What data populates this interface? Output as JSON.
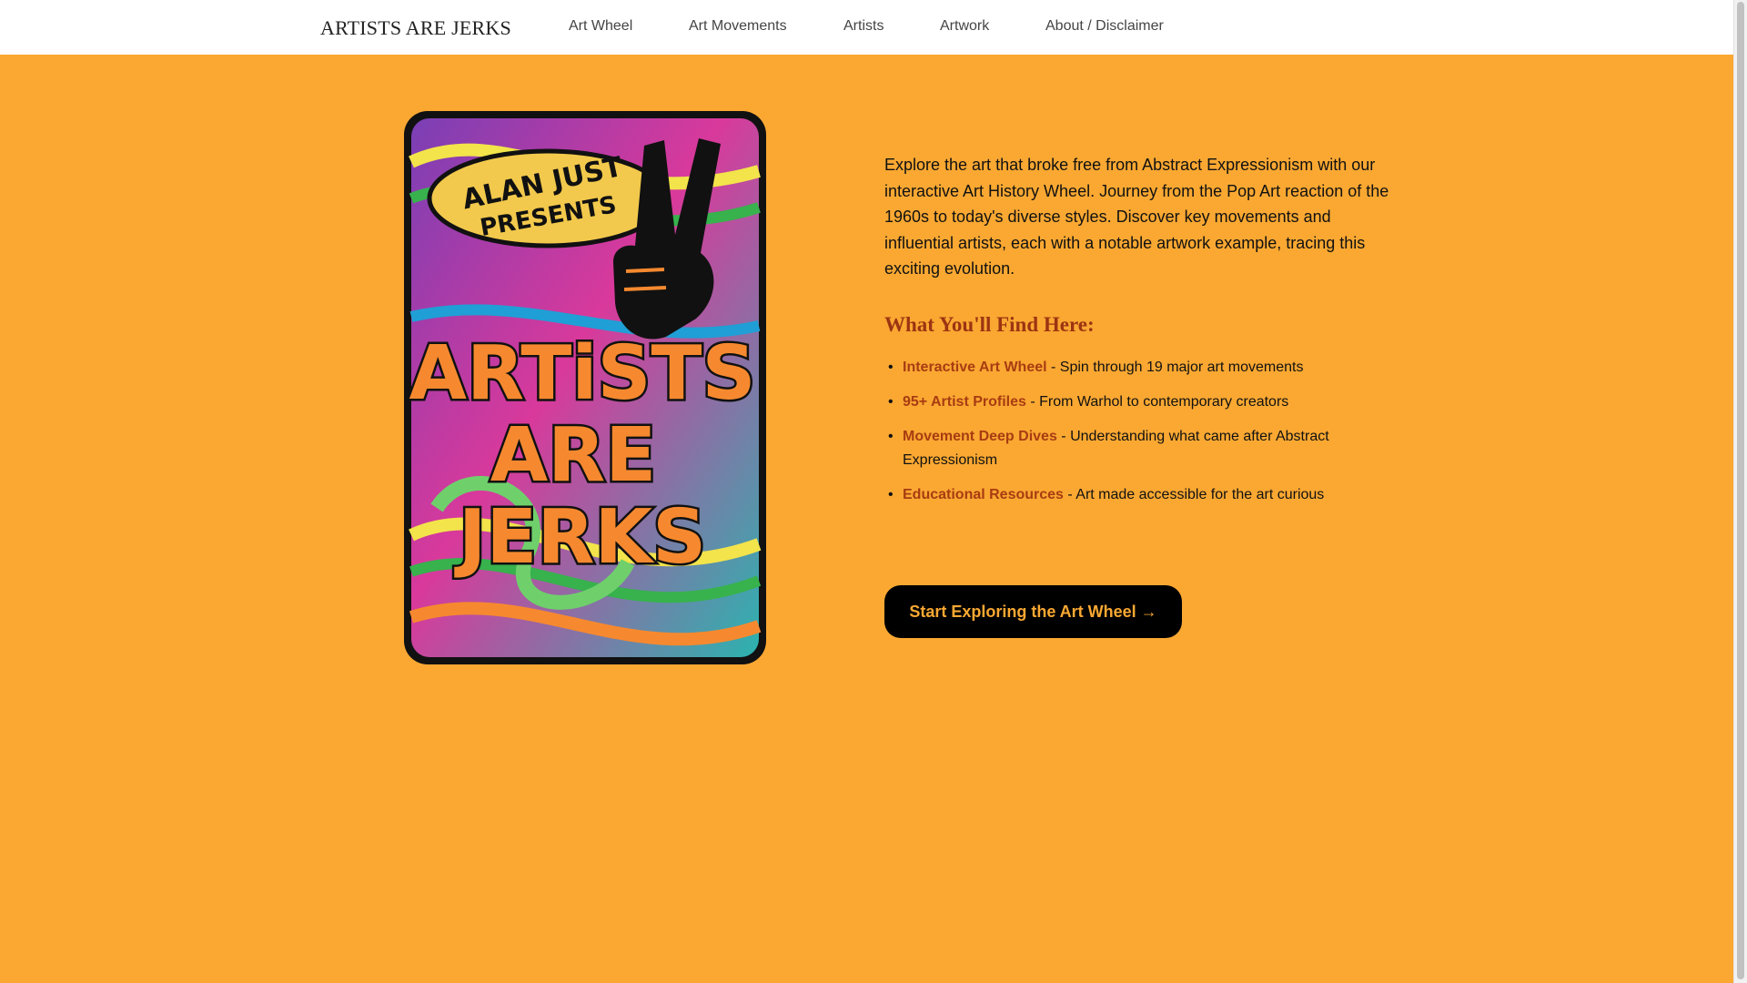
{
  "site": {
    "brand": "ARTISTS ARE JERKS"
  },
  "nav": {
    "items": [
      {
        "label": "Art Wheel"
      },
      {
        "label": "Art Movements"
      },
      {
        "label": "Artists"
      },
      {
        "label": "Artwork"
      },
      {
        "label": "About / Disclaimer"
      }
    ]
  },
  "poster": {
    "line1": "ALAN JUST",
    "line2": "PRESENTS",
    "word1": "ARTiSTS",
    "word2": "ARE",
    "word3": "JERKS"
  },
  "main": {
    "intro": "Explore the art that broke free from Abstract Expressionism with our interactive Art History Wheel. Journey from the Pop Art reaction of the 1960s to today's diverse styles. Discover key movements and influential artists, each with a notable artwork example, tracing this exciting evolution.",
    "features_title": "What You'll Find Here:",
    "features": [
      {
        "name": "Interactive Art Wheel",
        "text": " - Spin through 19 major art movements"
      },
      {
        "name": "95+ Artist Profiles",
        "text": " - From Warhol to contemporary creators"
      },
      {
        "name": "Movement Deep Dives",
        "text": " - Understanding what came after Abstract Expressionism"
      },
      {
        "name": "Educational Resources",
        "text": " - Art made accessible for the art curious"
      }
    ],
    "cta_label": "Start Exploring the Art Wheel →"
  },
  "colors": {
    "background": "#faa832",
    "header": "#ffffff",
    "accent_heading": "#9c3412",
    "feature_name": "#a83c12",
    "button_bg": "#000000",
    "button_text": "#faa832"
  },
  "icons": {
    "poster_hand": "peace-sign-hand-icon"
  }
}
